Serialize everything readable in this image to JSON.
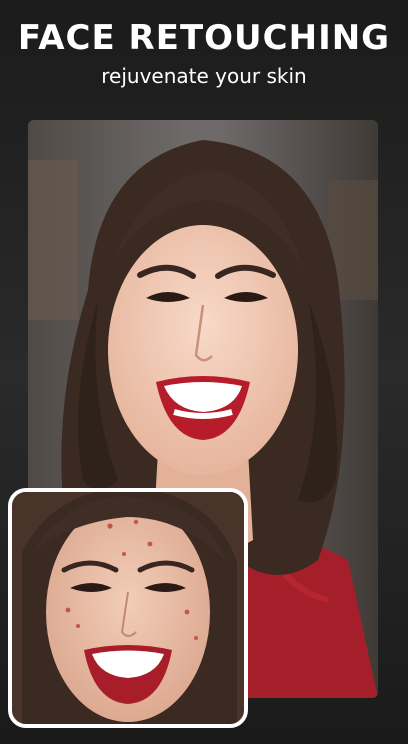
{
  "header": {
    "title": "FACE RETOUCHING",
    "subtitle": "rejuvenate your skin"
  },
  "images": {
    "after_photo": "retouched-face-photo",
    "before_photo": "before-face-photo-with-blemishes"
  },
  "colors": {
    "background": "#222222",
    "text": "#ffffff",
    "frame": "#ffffff",
    "shirt": "#a51f2b",
    "lips": "#b71c2a",
    "hair": "#3a2a22",
    "skin": "#f0c8b2"
  }
}
